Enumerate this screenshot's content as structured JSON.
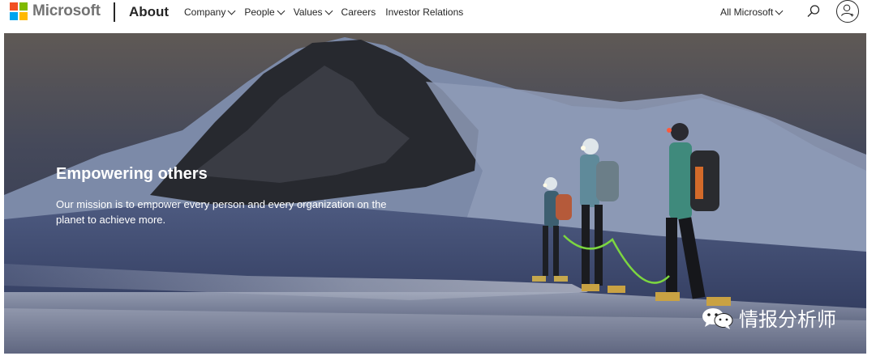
{
  "brand": {
    "name": "Microsoft",
    "logo_colors": [
      "#f25022",
      "#7fba00",
      "#00a4ef",
      "#ffb900"
    ]
  },
  "header": {
    "section_title": "About",
    "nav": [
      {
        "label": "Company",
        "has_dropdown": true
      },
      {
        "label": "People",
        "has_dropdown": true
      },
      {
        "label": "Values",
        "has_dropdown": true
      },
      {
        "label": "Careers",
        "has_dropdown": false
      },
      {
        "label": "Investor Relations",
        "has_dropdown": false
      }
    ],
    "all_microsoft": "All Microsoft",
    "search_icon": "search-icon",
    "account_icon": "account-icon"
  },
  "hero": {
    "title": "Empowering others",
    "text": "Our mission is to empower every person and every organization on the planet to achieve more."
  },
  "watermark": {
    "icon": "wechat-icon",
    "text": "情报分析师"
  }
}
